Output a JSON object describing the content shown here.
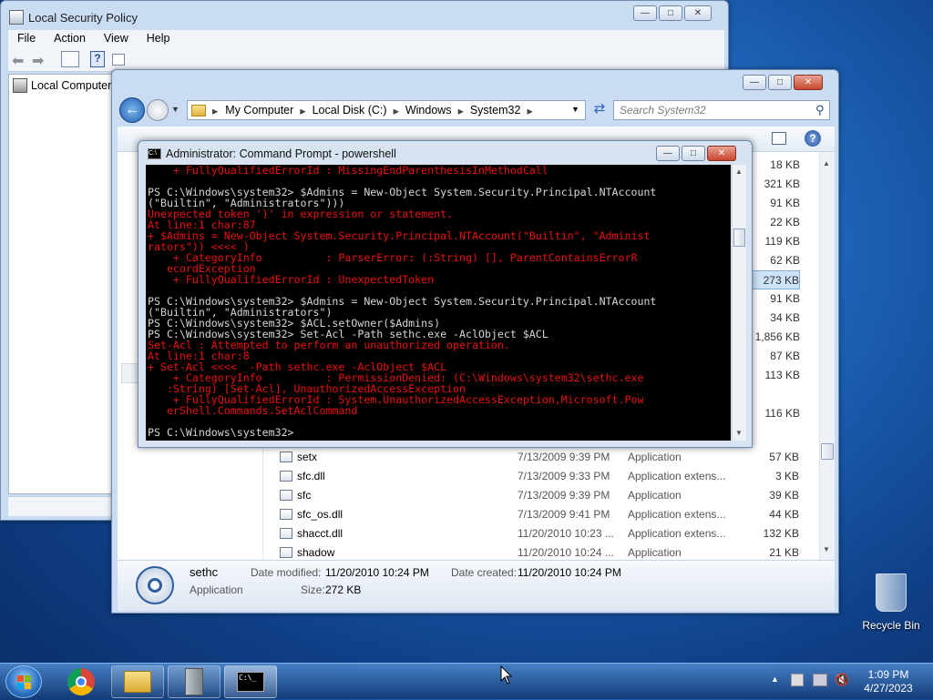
{
  "lsp": {
    "title": "Local Security Policy",
    "menu": [
      "File",
      "Action",
      "View",
      "Help"
    ],
    "tree_root": "Local Computer"
  },
  "explorer": {
    "breadcrumb": [
      "My Computer",
      "Local Disk (C:)",
      "Windows",
      "System32"
    ],
    "search_placeholder": "Search System32",
    "upper_sizes": [
      "18 KB",
      "321 KB",
      "91 KB",
      "22 KB",
      "119 KB",
      "62 KB",
      "273 KB",
      "91 KB",
      "34 KB",
      "1,856 KB",
      "87 KB",
      "113 KB",
      "",
      "116 KB"
    ],
    "selected_size_index": 6,
    "files": [
      {
        "name": "setx",
        "date": "7/13/2009 9:39 PM",
        "type": "Application",
        "size": "57 KB"
      },
      {
        "name": "sfc.dll",
        "date": "7/13/2009 9:33 PM",
        "type": "Application extens...",
        "size": "3 KB"
      },
      {
        "name": "sfc",
        "date": "7/13/2009 9:39 PM",
        "type": "Application",
        "size": "39 KB"
      },
      {
        "name": "sfc_os.dll",
        "date": "7/13/2009 9:41 PM",
        "type": "Application extens...",
        "size": "44 KB"
      },
      {
        "name": "shacct.dll",
        "date": "11/20/2010 10:23 ...",
        "type": "Application extens...",
        "size": "132 KB"
      },
      {
        "name": "shadow",
        "date": "11/20/2010 10:24 ...",
        "type": "Application",
        "size": "21 KB"
      }
    ],
    "details": {
      "name": "sethc",
      "type": "Application",
      "date_modified_label": "Date modified:",
      "date_modified": "11/20/2010 10:24 PM",
      "date_created_label": "Date created:",
      "date_created": "11/20/2010 10:24 PM",
      "size_label": "Size:",
      "size": "272 KB"
    }
  },
  "cmd": {
    "title": "Administrator:  Command Prompt - powershell",
    "lines": [
      {
        "t": "    + FullyQualifiedErrorId : MissingEndParenthesisInMethodCall",
        "c": "r"
      },
      {
        "t": "",
        "c": "w"
      },
      {
        "t": "PS C:\\Windows\\system32> $Admins = New-Object System.Security.Principal.NTAccount",
        "c": "w"
      },
      {
        "t": "(\"Builtin\", \"Administrators\")))",
        "c": "w"
      },
      {
        "t": "Unexpected token ')' in expression or statement.",
        "c": "r"
      },
      {
        "t": "At line:1 char:87",
        "c": "r"
      },
      {
        "t": "+ $Admins = New-Object System.Security.Principal.NTAccount(\"Builtin\", \"Administ",
        "c": "r"
      },
      {
        "t": "rators\")) <<<< )",
        "c": "r"
      },
      {
        "t": "    + CategoryInfo          : ParserError: (:String) [], ParentContainsErrorR",
        "c": "r"
      },
      {
        "t": "   ecordException",
        "c": "r"
      },
      {
        "t": "    + FullyQualifiedErrorId : UnexpectedToken",
        "c": "r"
      },
      {
        "t": "",
        "c": "w"
      },
      {
        "t": "PS C:\\Windows\\system32> $Admins = New-Object System.Security.Principal.NTAccount",
        "c": "w"
      },
      {
        "t": "(\"Builtin\", \"Administrators\")",
        "c": "w"
      },
      {
        "t": "PS C:\\Windows\\system32> $ACL.setOwner($Admins)",
        "c": "w"
      },
      {
        "t": "PS C:\\Windows\\system32> Set-Acl -Path sethc.exe -AclObject $ACL",
        "c": "w"
      },
      {
        "t": "Set-Acl : Attempted to perform an unauthorized operation.",
        "c": "r"
      },
      {
        "t": "At line:1 char:8",
        "c": "r"
      },
      {
        "t": "+ Set-Acl <<<<  -Path sethc.exe -AclObject $ACL",
        "c": "r"
      },
      {
        "t": "    + CategoryInfo          : PermissionDenied: (C:\\Windows\\system32\\sethc.exe",
        "c": "r"
      },
      {
        "t": "   :String) [Set-Acl], UnauthorizedAccessException",
        "c": "r"
      },
      {
        "t": "    + FullyQualifiedErrorId : System.UnauthorizedAccessException,Microsoft.Pow",
        "c": "r"
      },
      {
        "t": "   erShell.Commands.SetAclCommand",
        "c": "r"
      },
      {
        "t": "",
        "c": "w"
      },
      {
        "t": "PS C:\\Windows\\system32>",
        "c": "w"
      }
    ]
  },
  "desktop": {
    "recycle_bin": "Recycle Bin"
  },
  "taskbar": {
    "time": "1:09 PM",
    "date": "4/27/2023"
  },
  "colors": {
    "console_error": "#e81010",
    "console_text": "#d6d6d6",
    "selection": "#cde4f7"
  }
}
